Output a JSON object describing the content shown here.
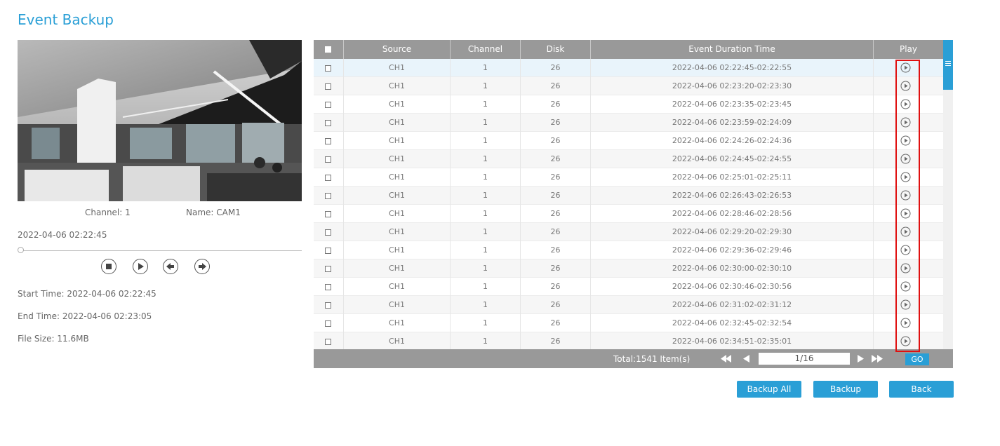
{
  "page": {
    "title": "Event Backup"
  },
  "preview": {
    "channel_label": "Channel: 1",
    "name_label": "Name: CAM1",
    "timestamp": "2022-04-06 02:22:45",
    "start_time": "Start Time: 2022-04-06 02:22:45",
    "end_time": "End Time: 2022-04-06 02:23:05",
    "file_size": "File Size: 11.6MB",
    "slider_progress": 0,
    "controls": [
      "stop-icon",
      "play-icon",
      "step-back-icon",
      "step-forward-icon"
    ]
  },
  "table": {
    "headers": {
      "source": "Source",
      "channel": "Channel",
      "disk": "Disk",
      "duration": "Event Duration Time",
      "play": "Play"
    },
    "rows": [
      {
        "source": "CH1",
        "channel": "1",
        "disk": "26",
        "time": "2022-04-06 02:22:45-02:22:55"
      },
      {
        "source": "CH1",
        "channel": "1",
        "disk": "26",
        "time": "2022-04-06 02:23:20-02:23:30"
      },
      {
        "source": "CH1",
        "channel": "1",
        "disk": "26",
        "time": "2022-04-06 02:23:35-02:23:45"
      },
      {
        "source": "CH1",
        "channel": "1",
        "disk": "26",
        "time": "2022-04-06 02:23:59-02:24:09"
      },
      {
        "source": "CH1",
        "channel": "1",
        "disk": "26",
        "time": "2022-04-06 02:24:26-02:24:36"
      },
      {
        "source": "CH1",
        "channel": "1",
        "disk": "26",
        "time": "2022-04-06 02:24:45-02:24:55"
      },
      {
        "source": "CH1",
        "channel": "1",
        "disk": "26",
        "time": "2022-04-06 02:25:01-02:25:11"
      },
      {
        "source": "CH1",
        "channel": "1",
        "disk": "26",
        "time": "2022-04-06 02:26:43-02:26:53"
      },
      {
        "source": "CH1",
        "channel": "1",
        "disk": "26",
        "time": "2022-04-06 02:28:46-02:28:56"
      },
      {
        "source": "CH1",
        "channel": "1",
        "disk": "26",
        "time": "2022-04-06 02:29:20-02:29:30"
      },
      {
        "source": "CH1",
        "channel": "1",
        "disk": "26",
        "time": "2022-04-06 02:29:36-02:29:46"
      },
      {
        "source": "CH1",
        "channel": "1",
        "disk": "26",
        "time": "2022-04-06 02:30:00-02:30:10"
      },
      {
        "source": "CH1",
        "channel": "1",
        "disk": "26",
        "time": "2022-04-06 02:30:46-02:30:56"
      },
      {
        "source": "CH1",
        "channel": "1",
        "disk": "26",
        "time": "2022-04-06 02:31:02-02:31:12"
      },
      {
        "source": "CH1",
        "channel": "1",
        "disk": "26",
        "time": "2022-04-06 02:32:45-02:32:54"
      },
      {
        "source": "CH1",
        "channel": "1",
        "disk": "26",
        "time": "2022-04-06 02:34:51-02:35:01"
      }
    ],
    "selected_row": 0
  },
  "pagination": {
    "total": "Total:1541 Item(s)",
    "page_value": "1/16",
    "go_label": "GO"
  },
  "actions": {
    "backup_all": "Backup All",
    "backup": "Backup",
    "back": "Back"
  },
  "colors": {
    "accent": "#2a9fd6",
    "header_bg": "#999999",
    "highlight_box": "#e01010"
  }
}
